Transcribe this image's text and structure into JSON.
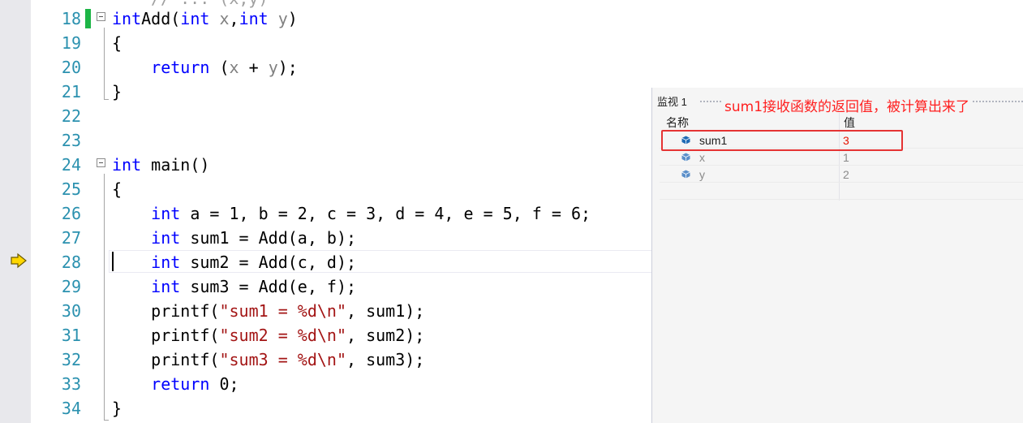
{
  "editor": {
    "top_partial": "// ... (x,y)",
    "lines": [
      {
        "num": "18",
        "tokens": [
          [
            "kw",
            "int"
          ],
          [
            "",
            "Add("
          ],
          [
            "kw",
            "int"
          ],
          [
            "pr",
            " x"
          ],
          [
            "",
            ","
          ],
          [
            "kw",
            "int"
          ],
          [
            "pr",
            " y"
          ],
          [
            "",
            ")"
          ]
        ]
      },
      {
        "num": "19",
        "tokens": [
          [
            "",
            "{"
          ]
        ]
      },
      {
        "num": "20",
        "tokens": [
          [
            "",
            "    "
          ],
          [
            "kw",
            "return"
          ],
          [
            "",
            " ("
          ],
          [
            "pr",
            "x"
          ],
          [
            "",
            " + "
          ],
          [
            "pr",
            "y"
          ],
          [
            "",
            ");"
          ]
        ]
      },
      {
        "num": "21",
        "tokens": [
          [
            "",
            "}"
          ]
        ]
      },
      {
        "num": "22",
        "tokens": []
      },
      {
        "num": "23",
        "tokens": []
      },
      {
        "num": "24",
        "tokens": [
          [
            "kw",
            "int"
          ],
          [
            "",
            " main()"
          ]
        ]
      },
      {
        "num": "25",
        "tokens": [
          [
            "",
            "{"
          ]
        ]
      },
      {
        "num": "26",
        "tokens": [
          [
            "",
            "    "
          ],
          [
            "kw",
            "int"
          ],
          [
            "",
            " a = 1, b = 2, c = 3, d = 4, e = 5, f = 6;"
          ]
        ]
      },
      {
        "num": "27",
        "tokens": [
          [
            "",
            "    "
          ],
          [
            "kw",
            "int"
          ],
          [
            "",
            " sum1 = Add(a, b);"
          ]
        ]
      },
      {
        "num": "28",
        "tokens": [
          [
            "",
            "    "
          ],
          [
            "kw",
            "int"
          ],
          [
            "",
            " sum2 = Add(c, d);"
          ]
        ]
      },
      {
        "num": "29",
        "tokens": [
          [
            "",
            "    "
          ],
          [
            "kw",
            "int"
          ],
          [
            "",
            " sum3 = Add(e, f);"
          ]
        ]
      },
      {
        "num": "30",
        "tokens": [
          [
            "",
            "    printf("
          ],
          [
            "st",
            "\"sum1 = %d\\n\""
          ],
          [
            "",
            ", sum1);"
          ]
        ]
      },
      {
        "num": "31",
        "tokens": [
          [
            "",
            "    printf("
          ],
          [
            "st",
            "\"sum2 = %d\\n\""
          ],
          [
            "",
            ", sum2);"
          ]
        ]
      },
      {
        "num": "32",
        "tokens": [
          [
            "",
            "    printf("
          ],
          [
            "st",
            "\"sum3 = %d\\n\""
          ],
          [
            "",
            ", sum3);"
          ]
        ]
      },
      {
        "num": "33",
        "tokens": [
          [
            "",
            "    "
          ],
          [
            "kw",
            "return"
          ],
          [
            "",
            " 0;"
          ]
        ]
      },
      {
        "num": "34",
        "tokens": [
          [
            "",
            "}"
          ]
        ]
      }
    ]
  },
  "watch": {
    "title": "监视 1",
    "annotation": "sum1接收函数的返回值，被计算出来了",
    "col_name": "名称",
    "col_value": "值",
    "rows": [
      {
        "name": "sum1",
        "value": "3",
        "name_color": "#1e1e1e",
        "value_color": "#e51400"
      },
      {
        "name": "x",
        "value": "1",
        "name_color": "#8a8a8a",
        "value_color": "#8a8a8a"
      },
      {
        "name": "y",
        "value": "2",
        "name_color": "#8a8a8a",
        "value_color": "#8a8a8a"
      },
      {
        "name": "",
        "value": "",
        "name_color": "#8a8a8a",
        "value_color": "#8a8a8a"
      }
    ]
  },
  "icons": {
    "execution_pointer": "execution-arrow-icon",
    "variable": "variable-cube-icon"
  }
}
